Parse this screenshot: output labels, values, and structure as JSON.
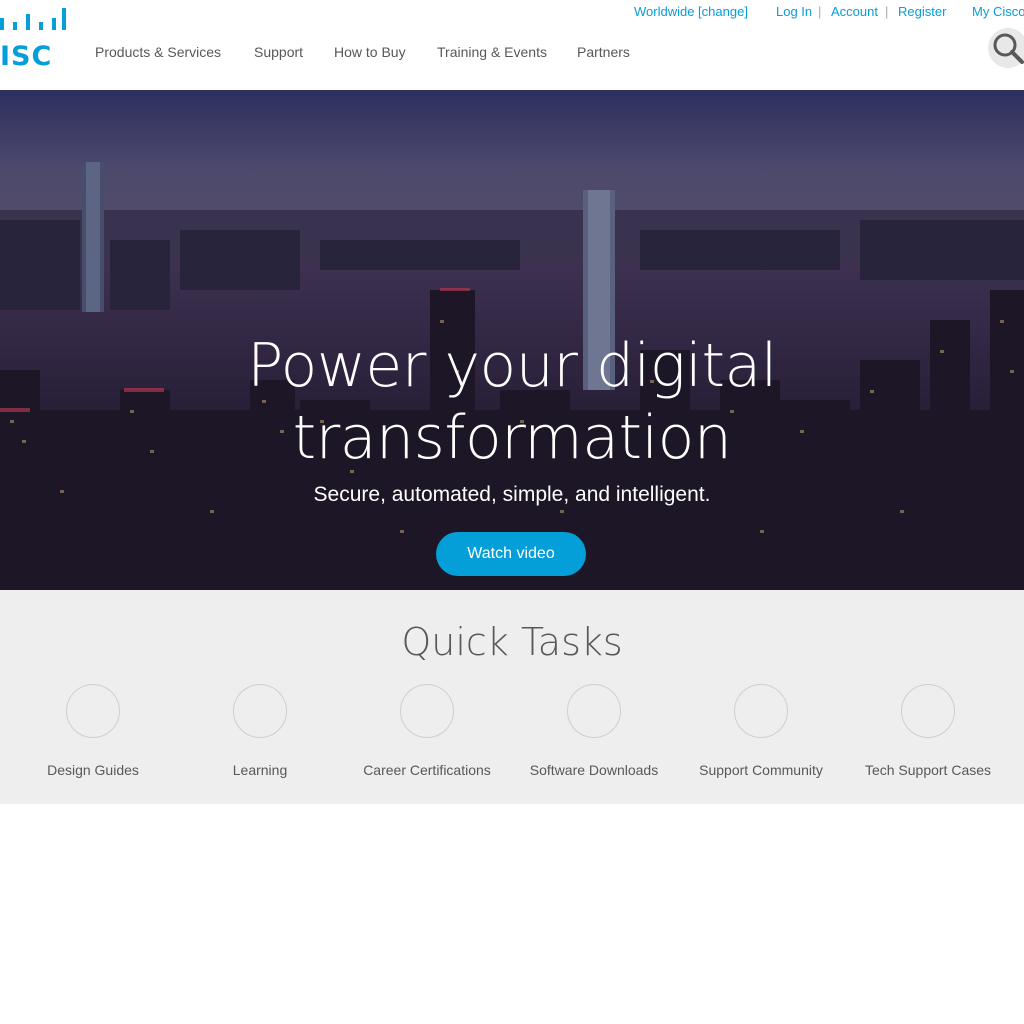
{
  "brand": {
    "name": "Cisco",
    "logo_text": "ISC",
    "accent_color": "#049fd9"
  },
  "utility_nav": {
    "worldwide": "Worldwide [change]",
    "login": "Log In",
    "separator": "|",
    "account": "Account",
    "register": "Register",
    "my_cisco": "My Cisco"
  },
  "main_nav": {
    "items": [
      {
        "label": "Products & Services"
      },
      {
        "label": "Support"
      },
      {
        "label": "How to Buy"
      },
      {
        "label": "Training & Events"
      },
      {
        "label": "Partners"
      }
    ],
    "search_icon": "search-icon"
  },
  "hero": {
    "title_line1": "Power your digital",
    "title_line2": "transformation",
    "subtitle": "Secure, automated, simple, and intelligent.",
    "cta_label": "Watch video",
    "cta_color": "#049fd9"
  },
  "quick_tasks": {
    "title": "Quick Tasks",
    "items": [
      {
        "label": "Design Guides"
      },
      {
        "label": "Learning"
      },
      {
        "label": "Career Certifications"
      },
      {
        "label": "Software Downloads"
      },
      {
        "label": "Support Community"
      },
      {
        "label": "Tech Support Cases"
      }
    ]
  }
}
